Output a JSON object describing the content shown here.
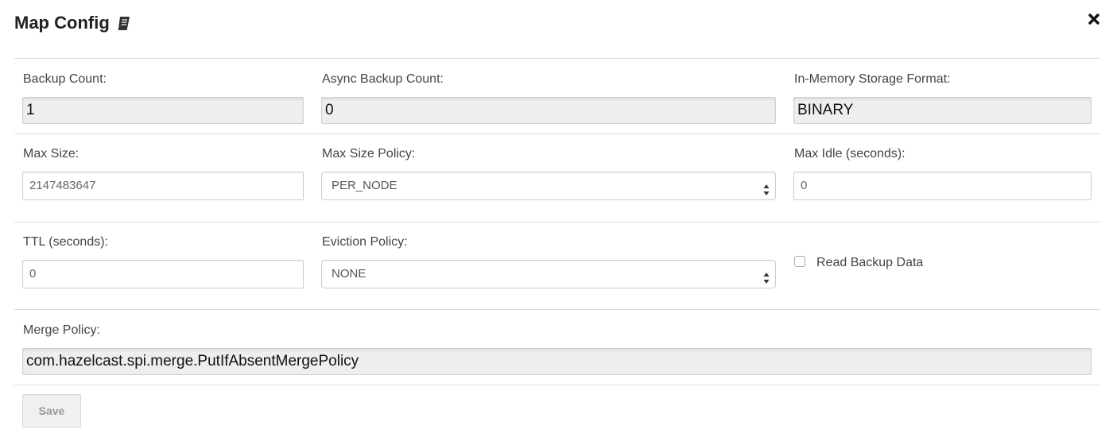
{
  "header": {
    "title": "Map Config",
    "book_icon": "book-icon",
    "close_icon": "close-icon"
  },
  "form": {
    "backup_count": {
      "label": "Backup Count:",
      "value": "1"
    },
    "async_backup_count": {
      "label": "Async Backup Count:",
      "value": "0"
    },
    "in_memory_format": {
      "label": "In-Memory Storage Format:",
      "value": "BINARY"
    },
    "max_size": {
      "label": "Max Size:",
      "placeholder": "2147483647"
    },
    "max_size_policy": {
      "label": "Max Size Policy:",
      "selected": "PER_NODE"
    },
    "max_idle": {
      "label": "Max Idle (seconds):",
      "value": "0"
    },
    "ttl": {
      "label": "TTL (seconds):",
      "value": "0"
    },
    "eviction_policy": {
      "label": "Eviction Policy:",
      "selected": "NONE"
    },
    "read_backup_data": {
      "label": "Read Backup Data",
      "checked": false
    },
    "merge_policy": {
      "label": "Merge Policy:",
      "value": "com.hazelcast.spi.merge.PutIfAbsentMergePolicy"
    }
  },
  "actions": {
    "save_label": "Save"
  },
  "colors": {
    "readonly_bg": "#eeeeee",
    "border": "#cccccc",
    "divider": "#dddddd",
    "disabled_text": "#999999"
  }
}
